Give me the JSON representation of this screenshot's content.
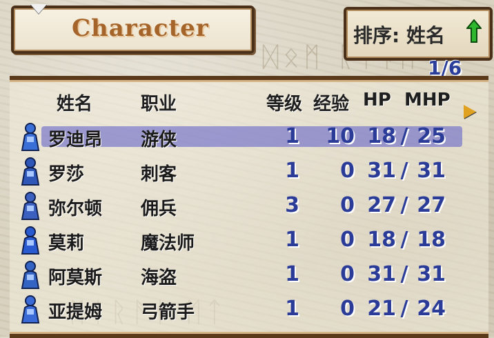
{
  "title": "Character",
  "sort": {
    "label": "排序: 姓名"
  },
  "page": "1/6",
  "headers": {
    "name": "姓名",
    "class": "职业",
    "level": "等级",
    "exp": "经验",
    "hp": "HP",
    "mhp": "MHP"
  },
  "units": [
    {
      "name": "罗迪昂",
      "class": "游侠",
      "level": "1",
      "exp": "10",
      "hp": "18",
      "mhp": "25",
      "selected": true
    },
    {
      "name": "罗莎",
      "class": "刺客",
      "level": "1",
      "exp": "0",
      "hp": "31",
      "mhp": "31"
    },
    {
      "name": "弥尔顿",
      "class": "佣兵",
      "level": "3",
      "exp": "0",
      "hp": "27",
      "mhp": "27"
    },
    {
      "name": "莫莉",
      "class": "魔法师",
      "level": "1",
      "exp": "0",
      "hp": "18",
      "mhp": "18"
    },
    {
      "name": "阿莫斯",
      "class": "海盗",
      "level": "1",
      "exp": "0",
      "hp": "31",
      "mhp": "31"
    },
    {
      "name": "亚提姆",
      "class": "弓箭手",
      "level": "1",
      "exp": "0",
      "hp": "21",
      "mhp": "24"
    }
  ],
  "colors": {
    "frame": "#4a3018",
    "number": "#2a3c98",
    "highlight": "#5a5ac8",
    "title": "#a4642a"
  },
  "icons": {
    "cursor": "cursor-pointer-icon",
    "sort_direction": "up-arrow-icon",
    "next_page": "right-arrow-icon"
  }
}
